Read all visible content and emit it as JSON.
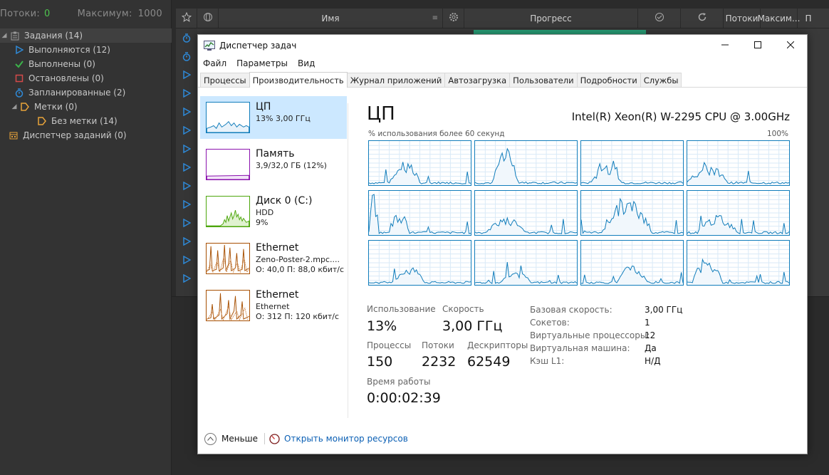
{
  "background_app": {
    "top_bar": {
      "threads_label": "Потоки:",
      "threads_value": "0",
      "max_label": "Максимум:",
      "max_value": "1000"
    },
    "tree": [
      {
        "label": "Задания (14)",
        "icon": "clipboard-icon",
        "color": "#9a9a9a"
      },
      {
        "label": "Выполняются (12)",
        "icon": "play-icon",
        "color": "#2f8ad8"
      },
      {
        "label": "Выполнены (0)",
        "icon": "check-icon",
        "color": "#3cb34a"
      },
      {
        "label": "Остановлены (0)",
        "icon": "stop-icon",
        "color": "#d34a4a"
      },
      {
        "label": "Запланированные (2)",
        "icon": "stopwatch-icon",
        "color": "#2f8ad8"
      },
      {
        "label": "Метки (0)",
        "icon": "tag-icon",
        "color": "#e8a33a"
      },
      {
        "label": "Без метки (14)",
        "icon": "tag-icon",
        "color": "#e8a33a"
      },
      {
        "label": "Диспетчер заданий (0)",
        "icon": "calendar-icon",
        "color": "#e8a33a"
      }
    ],
    "header": {
      "name": "Имя",
      "progress": "Прогресс",
      "threads": "Потоки",
      "max": "Максим...",
      "p": "П"
    }
  },
  "task_manager": {
    "title": "Диспетчер задач",
    "menu": [
      "Файл",
      "Параметры",
      "Вид"
    ],
    "tabs": [
      "Процессы",
      "Производительность",
      "Журнал приложений",
      "Автозагрузка",
      "Пользователи",
      "Подробности",
      "Службы"
    ],
    "active_tab": "Производительность",
    "side": [
      {
        "name": "ЦП",
        "line1": "13% 3,00 ГГц",
        "line2": "",
        "color": "#117dbb"
      },
      {
        "name": "Память",
        "line1": "3,9/32,0 ГБ (12%)",
        "line2": "",
        "color": "#8b12ae"
      },
      {
        "name": "Диск 0 (C:)",
        "line1": "HDD",
        "line2": "9%",
        "color": "#4da60c"
      },
      {
        "name": "Ethernet",
        "line1": "Zeno-Poster-2.mpc....",
        "line2": "О: 40,0 П: 88,0 кбит/с",
        "color": "#a74f01"
      },
      {
        "name": "Ethernet",
        "line1": "Ethernet",
        "line2": "О: 312 П: 120 кбит/с",
        "color": "#a74f01"
      }
    ],
    "cpu": {
      "title": "ЦП",
      "model": "Intel(R) Xeon(R) W-2295 CPU @ 3.00GHz",
      "util_label": "% использования более 60 секунд",
      "util_max": "100%",
      "stats": {
        "usage_label": "Использование",
        "usage_value": "13%",
        "speed_label": "Скорость",
        "speed_value": "3,00 ГГц",
        "processes_label": "Процессы",
        "processes_value": "150",
        "threads_label": "Потоки",
        "threads_value": "2232",
        "handles_label": "Дескрипторы",
        "handles_value": "62549",
        "uptime_label": "Время работы",
        "uptime_value": "0:00:02:39"
      },
      "info": [
        {
          "label": "Базовая скорость:",
          "value": "3,00 ГГц"
        },
        {
          "label": "Сокетов:",
          "value": "1"
        },
        {
          "label": "Виртуальные процессоры:",
          "value": "12"
        },
        {
          "label": "Виртуальная машина:",
          "value": "Да"
        },
        {
          "label": "Кэш L1:",
          "value": "Н/Д"
        }
      ]
    },
    "bottom": {
      "less": "Меньше",
      "resource_monitor": "Открыть монитор ресурсов"
    }
  }
}
